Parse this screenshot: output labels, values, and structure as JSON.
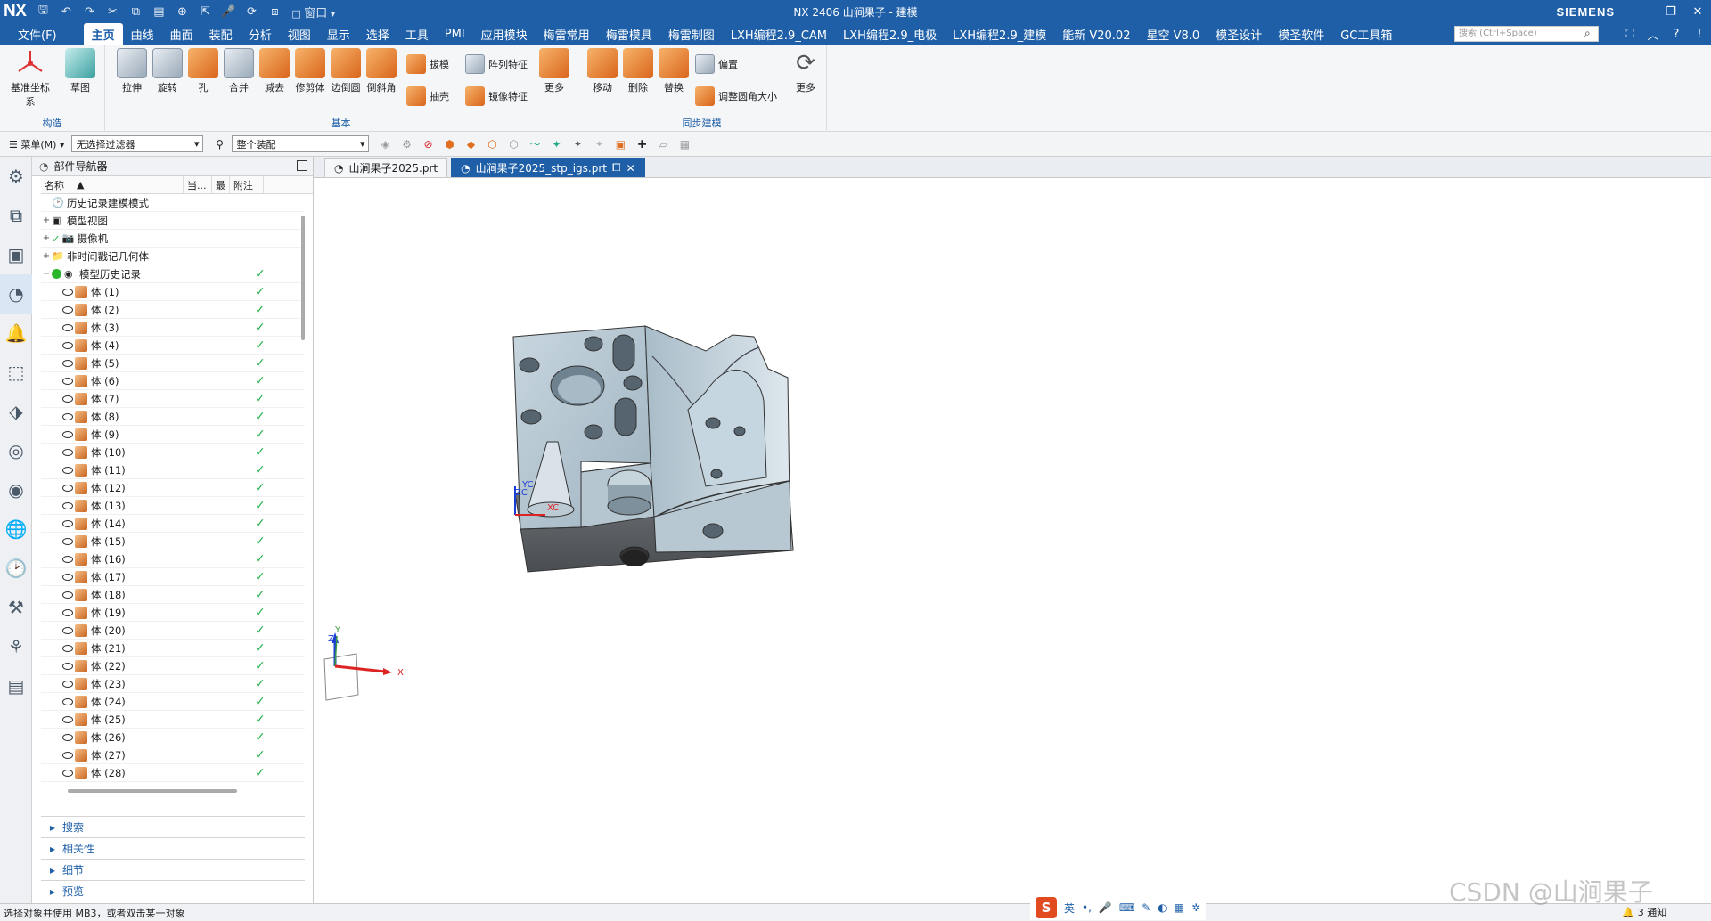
{
  "titlebar": {
    "logo": "NX",
    "title": "NX 2406 山涧果子 - 建模",
    "brand": "SIEMENS",
    "window_menu": "窗口"
  },
  "menubar": {
    "file": "文件(F)",
    "tabs": [
      "主页",
      "曲线",
      "曲面",
      "装配",
      "分析",
      "视图",
      "显示",
      "选择",
      "工具",
      "PMI",
      "应用模块",
      "梅雷常用",
      "梅雷模具",
      "梅雷制图",
      "LXH编程2.9_CAM",
      "LXH编程2.9_电极",
      "LXH编程2.9_建模",
      "能新 V20.02",
      "星空 V8.0",
      "模圣设计",
      "模圣软件",
      "GC工具箱"
    ],
    "active_tab": "主页",
    "search_placeholder": "搜索 (Ctrl+Space)"
  },
  "ribbon": {
    "group_construct": "构造",
    "group_basic": "基本",
    "group_sync": "同步建模",
    "btn_datum": "基准坐标系",
    "btn_sketch": "草图",
    "btn_extrude": "拉伸",
    "btn_revolve": "旋转",
    "btn_hole": "孔",
    "btn_unite": "合并",
    "btn_subtract": "减去",
    "btn_trim": "修剪体",
    "btn_edge_blend": "边倒圆",
    "btn_chamfer": "倒斜角",
    "btn_draft": "拔模",
    "btn_shell": "抽壳",
    "btn_pattern": "阵列特征",
    "btn_mirror": "镜像特征",
    "btn_more1": "更多",
    "btn_move": "移动",
    "btn_delete": "删除",
    "btn_replace": "替换",
    "btn_offset": "偏置",
    "btn_resize_blend": "调整圆角大小",
    "btn_more2": "更多"
  },
  "selbar": {
    "menu": "菜单(M)",
    "filter": "无选择过滤器",
    "scope": "整个装配"
  },
  "navigator": {
    "title": "部件导航器",
    "col_name": "名称",
    "col_current": "当...",
    "col_latest": "最",
    "col_comment": "附注",
    "top_items": [
      "历史记录建模模式",
      "模型视图",
      "摄像机",
      "非时间戳记几何体",
      "模型历史记录"
    ],
    "bodies": [
      "体 (1)",
      "体 (2)",
      "体 (3)",
      "体 (4)",
      "体 (5)",
      "体 (6)",
      "体 (7)",
      "体 (8)",
      "体 (9)",
      "体 (10)",
      "体 (11)",
      "体 (12)",
      "体 (13)",
      "体 (14)",
      "体 (15)",
      "体 (16)",
      "体 (17)",
      "体 (18)",
      "体 (19)",
      "体 (20)",
      "体 (21)",
      "体 (22)",
      "体 (23)",
      "体 (24)",
      "体 (25)",
      "体 (26)",
      "体 (27)",
      "体 (28)"
    ],
    "sections": [
      "搜索",
      "相关性",
      "细节",
      "预览"
    ]
  },
  "viewport": {
    "tab1": "山涧果子2025.prt",
    "tab2": "山涧果子2025_stp_igs.prt",
    "axis_x": "X",
    "axis_y": "Y",
    "axis_z": "Z",
    "wcs_x": "XC",
    "wcs_y": "YC",
    "wcs_z": "ZC"
  },
  "status": {
    "message": "选择对象并使用 MB3，或者双击某一对象",
    "notifications": "3 通知",
    "ime_lang": "英",
    "watermark": "CSDN @山涧果子"
  }
}
